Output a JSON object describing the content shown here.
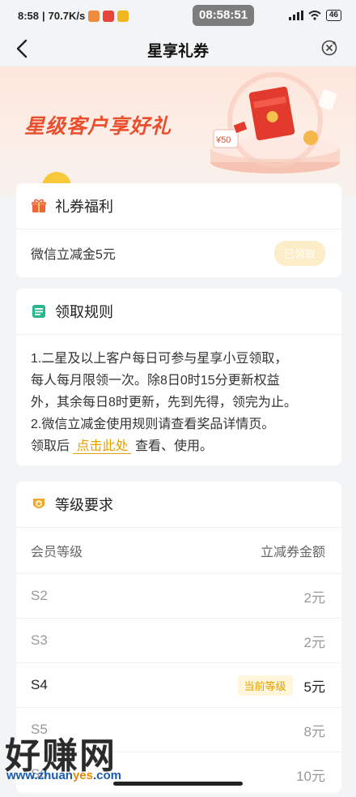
{
  "status_bar": {
    "time": "8:58",
    "speed": "70.7K/s",
    "clock_pill": "08:58:51",
    "battery": "46"
  },
  "nav": {
    "title": "星享礼券"
  },
  "banner": {
    "title": "星级客户享好礼",
    "coupon_tag": "¥50"
  },
  "benefit_card": {
    "title": "礼券福利",
    "item_label": "微信立减金5元",
    "button_label": "已领取"
  },
  "rules_card": {
    "title": "领取规则",
    "line1": "1.二星及以上客户每日可参与星享小豆领取，",
    "line2": "每人每月限领一次。除8日0时15分更新权益",
    "line3": "外，其余每日8时更新，先到先得，领完为止。",
    "line4": "2.微信立减金使用规则请查看奖品详情页。",
    "line5_prefix": "领取后",
    "line5_link": "点击此处",
    "line5_suffix": "查看、使用。"
  },
  "level_card": {
    "title": "等级要求",
    "col_level": "会员等级",
    "col_amount": "立减券金额",
    "current_badge": "当前等级",
    "rows": [
      {
        "level": "S2",
        "amount": "2元"
      },
      {
        "level": "S3",
        "amount": "2元"
      },
      {
        "level": "S4",
        "amount": "5元"
      },
      {
        "level": "S5",
        "amount": "8元"
      },
      {
        "level": "S6",
        "amount": "10元"
      }
    ]
  },
  "watermark": {
    "big": "好赚网",
    "url_a": "www.zhuan",
    "url_b": "yes",
    "url_c": ".com"
  },
  "colors": {
    "accent": "#ea4e2d",
    "gold": "#e3a000",
    "green": "#2bb58c"
  }
}
